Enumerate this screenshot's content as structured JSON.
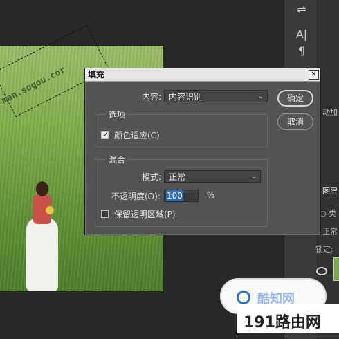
{
  "dialog": {
    "title": "填充",
    "close_glyph": "✕",
    "content_label": "内容:",
    "content_value": "内容识别",
    "ok_label": "确定",
    "cancel_label": "取消",
    "options_group": "选项",
    "color_adapt_label": "颜色适应(C)",
    "color_adapt_checked": true,
    "blend_group": "混合",
    "mode_label": "模式:",
    "mode_value": "正常",
    "opacity_label": "不透明度(O):",
    "opacity_value": "100",
    "opacity_unit": "%",
    "preserve_label": "保留透明区域(P)",
    "preserve_checked": false
  },
  "canvas": {
    "watermark": "man.sogou.cor"
  },
  "right_panel": {
    "text_auto": "动加调",
    "layers_tab": "图层",
    "kind_label": "○ 类",
    "blend_short": "正常",
    "lock_label": "锁定:",
    "tool_icons": [
      "adjust-icon",
      "paragraph-icon"
    ],
    "tool_glyph_1": "⇌",
    "tool_glyph_2": "A|",
    "tool_glyph_3": "¶",
    "eye_glyph": "👁"
  },
  "logo": {
    "bubble_text": "酷知网",
    "band_text": "191路由网"
  },
  "colors": {
    "dialog_bg": "#535353",
    "selection_highlight": "#2f6fb8"
  }
}
